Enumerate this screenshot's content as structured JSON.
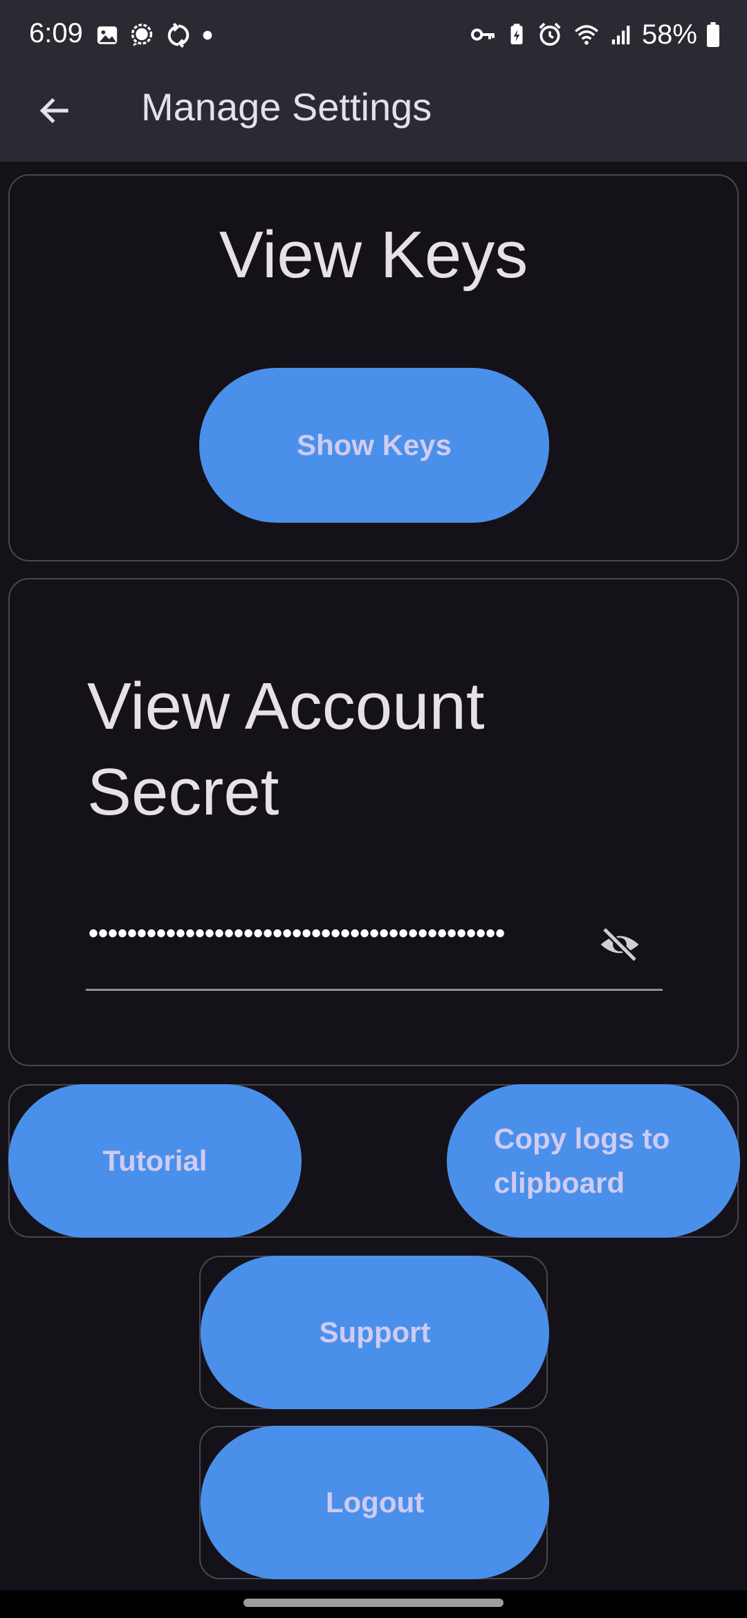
{
  "status_bar": {
    "time": "6:09",
    "left_icons": [
      "gallery-icon",
      "chat-bubble-icon",
      "sync-icon",
      "dot-icon"
    ],
    "right_icons": [
      "vpn-key-icon",
      "battery-saver-icon",
      "alarm-icon",
      "wifi-icon",
      "signal-icon"
    ],
    "battery_percent": "58%"
  },
  "app_bar": {
    "title": "Manage Settings",
    "back_icon": "arrow-back-icon"
  },
  "view_keys": {
    "title": "View Keys",
    "button_label": "Show Keys"
  },
  "account_secret": {
    "title": "View Account Secret",
    "masked_value": "•••••••••••••••••••••••••••••••••••••••••••",
    "toggle_icon": "visibility-off-icon"
  },
  "actions": {
    "tutorial_label": "Tutorial",
    "copy_logs_label": "Copy logs to clipboard",
    "support_label": "Support",
    "logout_label": "Logout"
  },
  "colors": {
    "background": "#141218",
    "app_bar": "#2a2a32",
    "button": "#4a90ea",
    "button_text": "#d0cbf3",
    "text": "#e6e1e9",
    "outline": "#48464f"
  }
}
